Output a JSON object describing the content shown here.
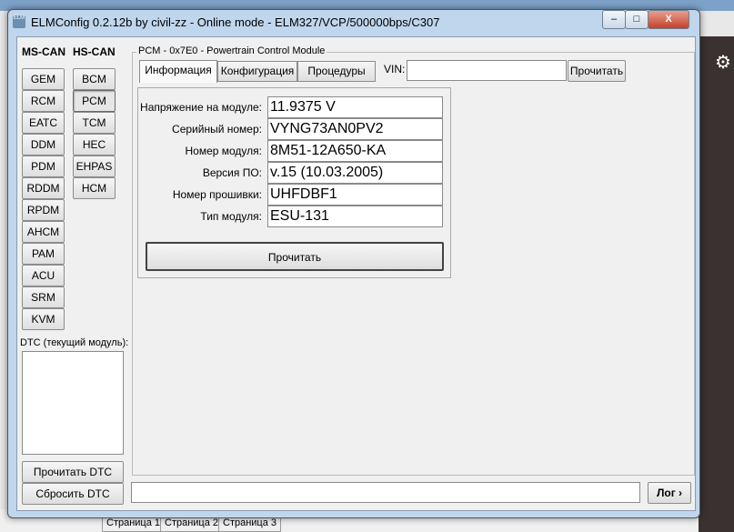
{
  "background": {
    "tabs": [
      "Страница 1",
      "Страница 2",
      "Страница 3"
    ],
    "left_buttons": [
      "RCM",
      "PCM"
    ]
  },
  "window": {
    "title": "ELMConfig 0.2.12b by civil-zz - Online mode - ELM327/VCP/500000bps/C307",
    "icon_text": "ELM",
    "minimize": "–",
    "maximize": "□",
    "close": "X"
  },
  "left": {
    "ms_can_label": "MS-CAN",
    "hs_can_label": "HS-CAN",
    "ms_can": [
      "GEM",
      "RCM",
      "EATC",
      "DDM",
      "PDM",
      "RDDM",
      "RPDM",
      "AHCM",
      "PAM",
      "ACU",
      "SRM",
      "KVM"
    ],
    "hs_can": [
      "BCM",
      "PCM",
      "TCM",
      "HEC",
      "EHPAS",
      "HCM"
    ],
    "selected": "PCM",
    "dtc_label": "DTC (текущий модуль):",
    "read_dtc": "Прочитать DTC",
    "clear_dtc": "Сбросить DTC"
  },
  "module": {
    "legend": "PCM - 0x7E0 - Powertrain Control Module",
    "tabs": [
      "Информация",
      "Конфигурация",
      "Процедуры"
    ],
    "active_tab": "Информация",
    "vin_label": "VIN:",
    "vin_value": "",
    "vin_read": "Прочитать",
    "rows": [
      {
        "label": "Напряжение на модуле:",
        "value": "11.9375 V"
      },
      {
        "label": "Серийный номер:",
        "value": "VYNG73AN0PV2"
      },
      {
        "label": "Номер модуля:",
        "value": "8M51-12A650-KA"
      },
      {
        "label": "Версия ПО:",
        "value": "v.15 (10.03.2005)"
      },
      {
        "label": "Номер прошивки:",
        "value": "UHFDBF1"
      },
      {
        "label": "Тип модуля:",
        "value": "ESU-131"
      }
    ],
    "read_button": "Прочитать"
  },
  "bottom": {
    "log_value": "",
    "log_button": "Лог ›"
  }
}
